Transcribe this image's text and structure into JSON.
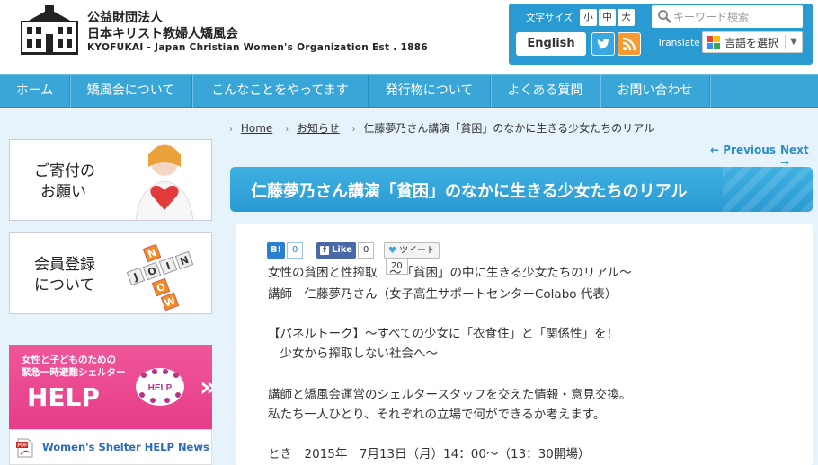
{
  "header": {
    "org_line1": "公益財団法人",
    "org_line2": "日本キリスト教婦人矯風会",
    "org_line3": "KYOFUKAI - Japan Christian Women's Organization Est . 1886"
  },
  "utility": {
    "font_size_label": "文字サイズ",
    "font_sizes": [
      "小",
      "中",
      "大"
    ],
    "search_placeholder": "キーワード検索",
    "english_label": "English",
    "translate_label": "Translate",
    "language_select": "言語を選択",
    "twitter_icon": "twitter-icon",
    "rss_icon": "rss-icon",
    "accent_color": "#2a9ad2"
  },
  "nav": {
    "items": [
      "ホーム",
      "矯風会について",
      "こんなことをやってます",
      "発行物について",
      "よくある質問",
      "お問い合わせ"
    ]
  },
  "breadcrumb": {
    "home": "Home",
    "news": "お知らせ",
    "current": "仁藤夢乃さん講演「貧困」のなかに生きる少女たちのリアル"
  },
  "pager": {
    "prev": "← Previous",
    "next": "Next →"
  },
  "article": {
    "title": "仁藤夢乃さん講演「貧困」のなかに生きる少女たちのリアル",
    "share": {
      "hatena_label": "B!",
      "hatena_count": "0",
      "fb_label": "Like",
      "fb_count": "0",
      "tweet_label": "ツイート",
      "tweet_count": "20"
    },
    "lines": [
      "女性の貧困と性搾取　～「貧困」の中に生きる少女たちのリアル～",
      "講師　仁藤夢乃さん（女子高生サポートセンターColabo 代表）",
      "",
      "【パネルトーク】～すべての少女に「衣食住」と「関係性」を！",
      "　少女から搾取しない社会へ～",
      "",
      "講師と矯風会運営のシェルタースタッフを交えた情報・意見交換。",
      "私たち一人ひとり、それぞれの立場で何ができるか考えます。",
      "",
      "とき　2015年　7月13日（月）14：00～（13：30開場）"
    ]
  },
  "sidebar": {
    "donation_text": [
      "ご寄付の",
      "お願い"
    ],
    "member_text": [
      "会員登録",
      "について"
    ],
    "join_letters": [
      "J",
      "O",
      "I",
      "N",
      "N",
      "O",
      "W"
    ],
    "help_small": [
      "女性と子どものための",
      "緊急一時避難シェルター"
    ],
    "help_big": "HELP",
    "help_badge": "HELP",
    "news_title": "Women's Shelter HELP News"
  }
}
